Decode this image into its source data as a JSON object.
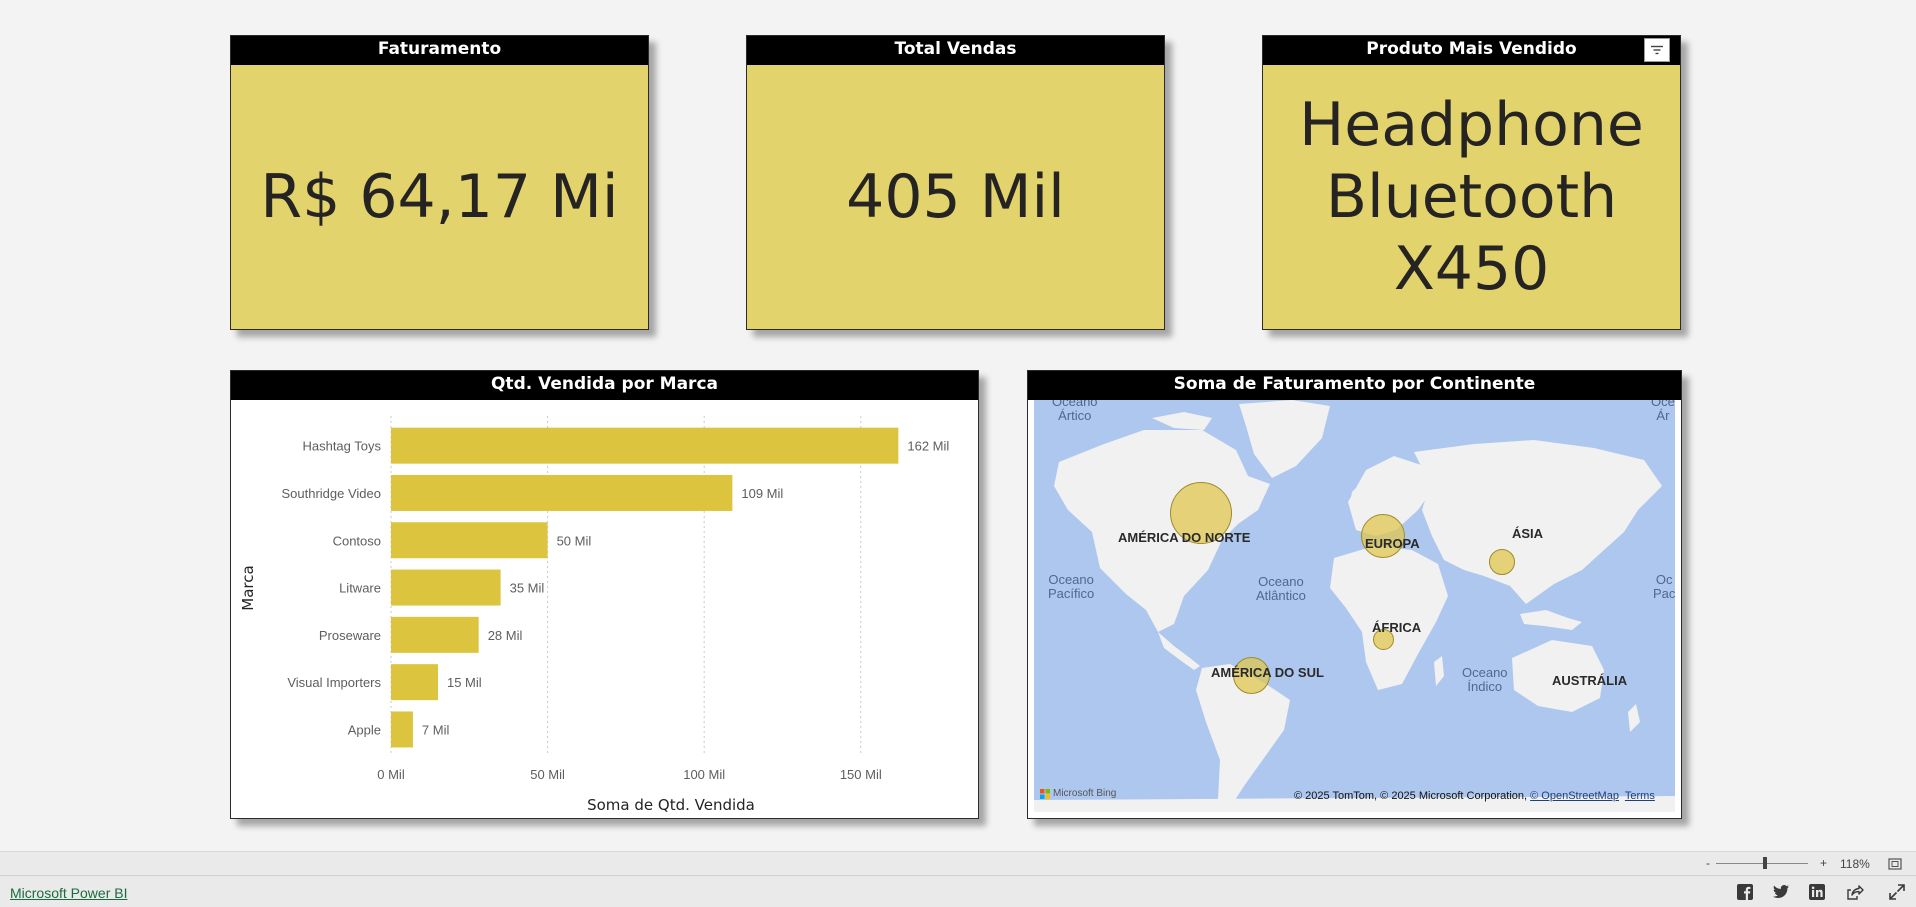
{
  "kpis": {
    "faturamento": {
      "title": "Faturamento",
      "value": "R$ 64,17 Mi"
    },
    "total_vendas": {
      "title": "Total Vendas",
      "value": "405 Mil"
    },
    "produto": {
      "title": "Produto Mais Vendido",
      "value_lines": [
        "Headphone",
        "Bluetooth",
        "X450"
      ]
    }
  },
  "bar_panel": {
    "title": "Qtd. Vendida por Marca"
  },
  "map_panel": {
    "title": "Soma de Faturamento por Continente",
    "continents": [
      "AMÉRICA DO NORTE",
      "EUROPA",
      "ÁSIA",
      "ÁFRICA",
      "AMÉRICA DO SUL",
      "AUSTRÁLIA"
    ],
    "oceans": [
      "Oceano\nÁrtico",
      "Oceano\nPacífico",
      "Oceano\nAtlântico",
      "Oceano\nÍndico",
      "Oce\nÁr",
      "Oc\nPac"
    ],
    "bing_logo": "Microsoft Bing",
    "attribution": "© 2025 TomTom, © 2025 Microsoft Corporation,",
    "osm_link": "© OpenStreetMap",
    "terms_link": "Terms"
  },
  "chart_data": {
    "type": "bar",
    "orientation": "horizontal",
    "title": "Qtd. Vendida por Marca",
    "categories": [
      "Hashtag Toys",
      "Southridge Video",
      "Contoso",
      "Litware",
      "Proseware",
      "Visual Importers",
      "Apple"
    ],
    "values": [
      162,
      109,
      50,
      35,
      28,
      15,
      7
    ],
    "data_labels": [
      "162 Mil",
      "109 Mil",
      "50 Mil",
      "35 Mil",
      "28 Mil",
      "15 Mil",
      "7 Mil"
    ],
    "xlabel": "Soma de Qtd. Vendida",
    "ylabel": "Marca",
    "xticks": [
      0,
      50,
      100,
      150
    ],
    "xtick_labels": [
      "0 Mil",
      "50 Mil",
      "100 Mil",
      "150 Mil"
    ],
    "xlim": [
      0,
      182
    ],
    "grid": true,
    "bar_color": "#dcc43f"
  },
  "colors": {
    "kpi_bg": "#e2d36c",
    "header_bg": "#000000",
    "bubble": "#e0c64a"
  },
  "footer": {
    "powerbi_link": "Microsoft Power BI",
    "zoom_level": "118%",
    "zoom_minus": "-",
    "zoom_plus": "+"
  }
}
